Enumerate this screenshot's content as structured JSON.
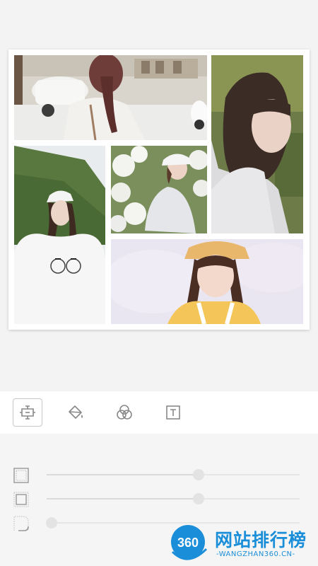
{
  "collage": {
    "photos": [
      {
        "id": "photo-1",
        "subject": "back view of girl with braided hair on street"
      },
      {
        "id": "photo-2",
        "subject": "portrait of girl with long dark hair"
      },
      {
        "id": "photo-3",
        "subject": "girl in white cap and white t-shirt on hill"
      },
      {
        "id": "photo-4",
        "subject": "girl in cap among white hydrangeas"
      },
      {
        "id": "photo-5",
        "subject": "girl with straw hat and braids, soft light"
      }
    ]
  },
  "toolbar": {
    "tools": [
      {
        "icon": "layout-icon",
        "active": true
      },
      {
        "icon": "paint-bucket-icon",
        "active": false
      },
      {
        "icon": "filter-circles-icon",
        "active": false
      },
      {
        "icon": "text-frame-icon",
        "active": false
      }
    ]
  },
  "sliders": [
    {
      "icon": "outer-border-icon",
      "value": 0.6
    },
    {
      "icon": "inner-border-icon",
      "value": 0.6
    },
    {
      "icon": "corner-radius-icon",
      "value": 0.02
    }
  ],
  "watermark": {
    "logo_text": "360",
    "title": "网站排行榜",
    "subtitle": "-WANGZHAN360.CN-"
  }
}
